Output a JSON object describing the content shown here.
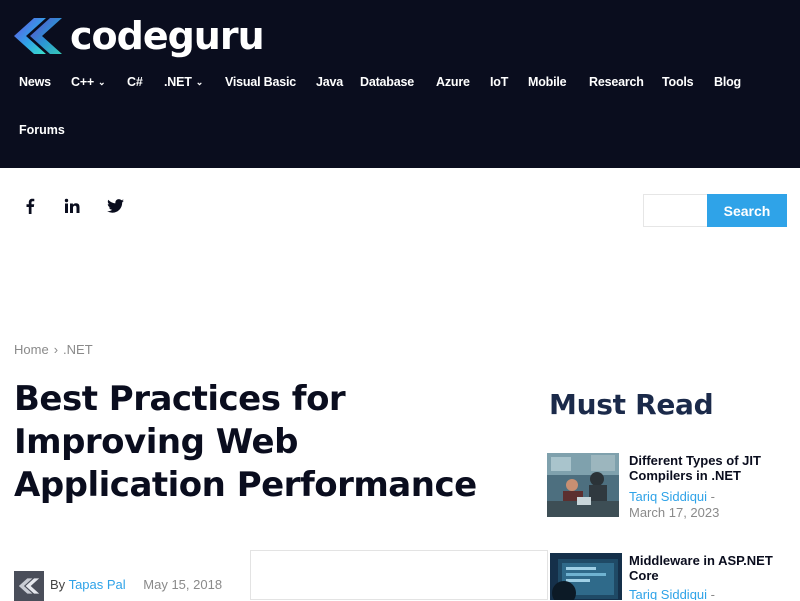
{
  "brand": {
    "name": "codeguru"
  },
  "nav": {
    "items": [
      {
        "label": "News",
        "dropdown": false
      },
      {
        "label": "C++",
        "dropdown": true
      },
      {
        "label": "C#",
        "dropdown": false
      },
      {
        "label": ".NET",
        "dropdown": true
      },
      {
        "label": "Visual Basic",
        "dropdown": false
      },
      {
        "label": "Java",
        "dropdown": false
      },
      {
        "label": "Database",
        "dropdown": false
      },
      {
        "label": "Azure",
        "dropdown": false
      },
      {
        "label": "IoT",
        "dropdown": false
      },
      {
        "label": "Mobile",
        "dropdown": false
      },
      {
        "label": "Research",
        "dropdown": false
      },
      {
        "label": "Tools",
        "dropdown": false
      },
      {
        "label": "Blog",
        "dropdown": false
      }
    ],
    "forums": "Forums",
    "chevron": "⌄"
  },
  "social": [
    {
      "icon": "facebook-icon"
    },
    {
      "icon": "linkedin-icon"
    },
    {
      "icon": "twitter-icon"
    }
  ],
  "search": {
    "button_label": "Search",
    "placeholder": "",
    "value": ""
  },
  "breadcrumb": {
    "home": "Home",
    "separator": "›",
    "current": ".NET"
  },
  "article": {
    "title": "Best Practices for Improving Web Application Performance",
    "by_label": "By",
    "author": "Tapas Pal",
    "date": "May 15, 2018"
  },
  "ad": {
    "close": "✕"
  },
  "sidebar": {
    "heading": "Must Read",
    "cards": [
      {
        "title": "Different Types of JIT Compilers in .NET",
        "author": "Tariq Siddiqui",
        "dash": "-",
        "date": "March 17, 2023"
      },
      {
        "title": "Middleware in ASP.NET Core",
        "author": "Tariq Siddiqui",
        "dash": "-",
        "date": ""
      }
    ]
  },
  "colors": {
    "header_bg": "#0a0d1e",
    "accent": "#2fa3e8",
    "heading": "#1b2a4a",
    "logo_gradient": [
      "#6a4de0",
      "#2fa3e8",
      "#3be0c8"
    ]
  }
}
